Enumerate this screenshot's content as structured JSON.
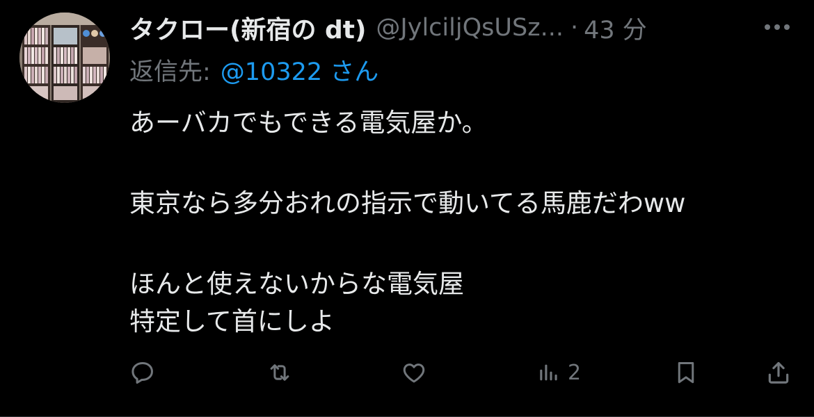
{
  "tweet": {
    "display_name": "タクロー(新宿の dt)",
    "handle": "@JylciljQsUSz...",
    "separator": "·",
    "time": "43 分",
    "reply_label": "返信先:",
    "reply_mention": "@10322 さん",
    "body_lines": [
      "あーバカでもできる電気屋か。",
      "東京なら多分おれの指示で動いてる馬鹿だわww",
      "ほんと使えないからな電気屋",
      "特定して首にしよ"
    ]
  },
  "actions": {
    "reply_icon": "reply-icon",
    "retweet_icon": "retweet-icon",
    "like_icon": "like-icon",
    "views_icon": "views-icon",
    "views_count": "2",
    "bookmark_icon": "bookmark-icon",
    "share_icon": "share-icon"
  },
  "colors": {
    "background": "#000000",
    "primary_text": "#e7e9ea",
    "secondary_text": "#71767b",
    "accent": "#1d9bf0"
  }
}
